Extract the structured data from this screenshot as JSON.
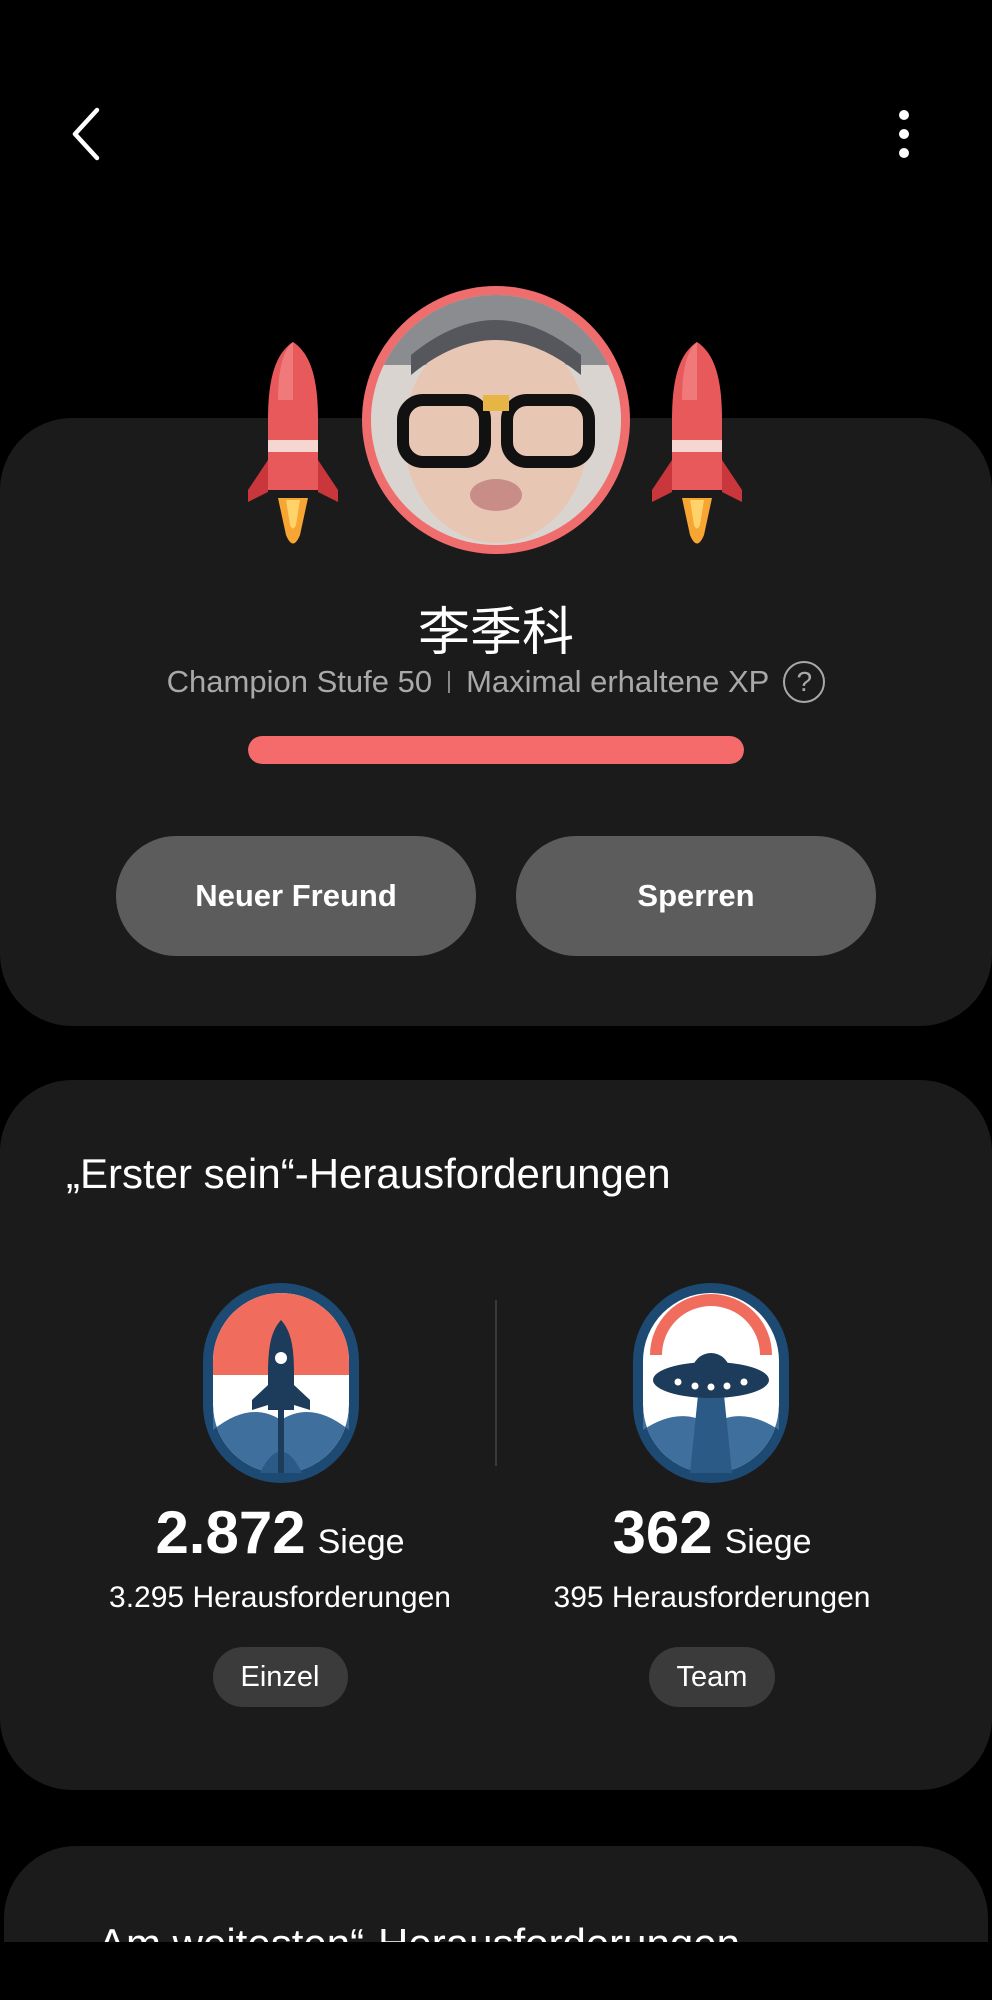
{
  "header": {
    "back_icon": "chevron-left-icon",
    "more_icon": "more-vertical-icon"
  },
  "profile": {
    "name": "李季科",
    "level_text": "Champion Stufe 50",
    "xp_text": "Maximal erhaltene XP",
    "help_symbol": "?",
    "xp_progress": 1.0,
    "accent_color": "#f56b6b"
  },
  "actions": {
    "add_friend_label": "Neuer Freund",
    "block_label": "Sperren"
  },
  "first_challenges": {
    "title": "„Erster sein“-Herausforderungen",
    "single": {
      "wins": "2.872",
      "wins_label": "Siege",
      "challenges": "3.295 Herausforderungen",
      "chip": "Einzel"
    },
    "team": {
      "wins": "362",
      "wins_label": "Siege",
      "challenges": "395 Herausforderungen",
      "chip": "Team"
    }
  },
  "next_section": {
    "title": "„Am weitesten“-Herausforderungen"
  }
}
